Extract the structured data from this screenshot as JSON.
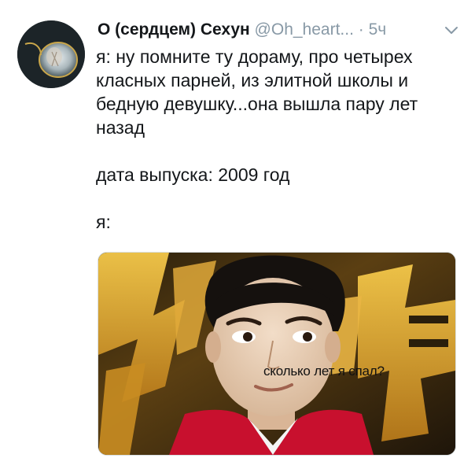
{
  "tweet": {
    "author": {
      "display_name": "О (сердцем) Сехун",
      "handle": "@Oh_heart...",
      "avatar_icon": "profile-avatar"
    },
    "separator": "·",
    "time": "5ч",
    "menu_icon": "chevron-down-icon",
    "text": {
      "line1": "я: ну помните ту дораму, про четырех класных парней, из элитной школы и бедную девушку...она вышла пару лет назад",
      "line2": "дата выпуска: 2009 год",
      "line3": "я:"
    },
    "media": {
      "caption": "сколько лет я спал?"
    }
  },
  "colors": {
    "text": "#14171a",
    "secondary": "#8899a6",
    "jacket_red": "#c8102e",
    "background_gold": "#d9a520"
  }
}
